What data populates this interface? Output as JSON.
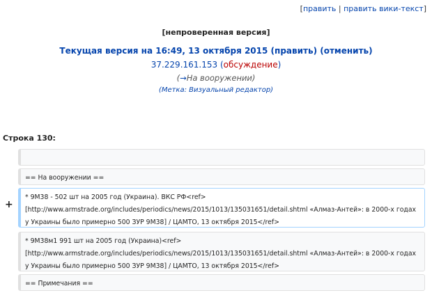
{
  "top_links": {
    "open_bracket": "[",
    "edit": "править",
    "separator": " | ",
    "edit_wiki": "править вики-текст",
    "close_bracket": "]"
  },
  "revision": {
    "unchecked": "[непроверенная версия]",
    "current_prefix": "Текущая версия на 16:49, 13 октября 2015",
    "edit_open": " (",
    "edit_label": "править",
    "edit_close": ")",
    "undo_open": " (",
    "undo_label": "отменить",
    "undo_close": ")",
    "ip": "37.229.161.153",
    "talk_open": " (",
    "talk_label": "обсуждение",
    "talk_close": ")",
    "summary_open": "(",
    "summary_arrow": "→",
    "summary_section": "На вооружении",
    "summary_close": ")",
    "tag_open": "(",
    "tag_label": "Метка",
    "tag_sep": ": ",
    "tag_value": "Визуальный редактор",
    "tag_close": ")"
  },
  "diff": {
    "line_label": "Строка 130:",
    "added_marker": "+",
    "lines": [
      {
        "text": "",
        "type": "context"
      },
      {
        "text": "== На вооружении ==",
        "type": "context"
      },
      {
        "text": "* 9М38 - 502 шт на 2005 год (Украина). ВКС РФ<ref>[http://www.armstrade.org/includes/periodics/news/2015/1013/135031651/detail.shtml «Алмаз-Антей»: в 2000-х годах у Украины было примерно 500 ЗУР 9М38] / ЦАМТО, 13 октября 2015</ref>",
        "type": "added"
      },
      {
        "text": "* 9М38м1 991 шт на 2005 год (Украина)<ref>[http://www.armstrade.org/includes/periodics/news/2015/1013/135031651/detail.shtml «Алмаз-Антей»: в 2000-х годах у Украины было примерно 500 ЗУР 9М38] / ЦАМТО, 13 октября 2015</ref>",
        "type": "context"
      },
      {
        "text": "== Примечания ==",
        "type": "context"
      }
    ]
  }
}
